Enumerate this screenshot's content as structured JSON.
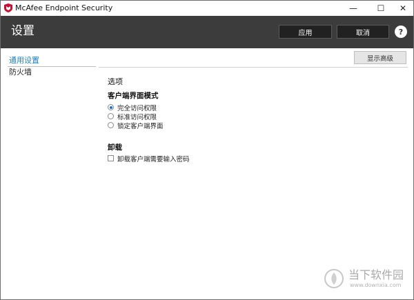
{
  "window": {
    "title": "McAfee Endpoint Security",
    "controls": {
      "minimize": "—",
      "maximize": "☐",
      "close": "✕"
    }
  },
  "header": {
    "title": "设置",
    "apply_label": "应用",
    "cancel_label": "取消",
    "help_label": "?"
  },
  "sidebar": {
    "items": [
      {
        "label": "通用设置",
        "selected": true
      },
      {
        "label": "防火墙",
        "selected": false
      }
    ]
  },
  "main": {
    "show_advanced_label": "显示高级",
    "options_heading": "选项",
    "client_mode": {
      "heading": "客户端界面模式",
      "options": [
        {
          "label": "完全访问权限",
          "checked": true
        },
        {
          "label": "标准访问权限",
          "checked": false
        },
        {
          "label": "锁定客户端界面",
          "checked": false
        }
      ]
    },
    "uninstall": {
      "heading": "卸载",
      "require_password_label": "卸载客户端需要输入密码",
      "require_password_checked": false
    }
  },
  "watermark": {
    "text": "当下软件园",
    "url": "www.downxia.com"
  },
  "colors": {
    "header_bg": "#3c3c3c",
    "accent": "#1e7fc7",
    "brand_red": "#c8102e"
  }
}
